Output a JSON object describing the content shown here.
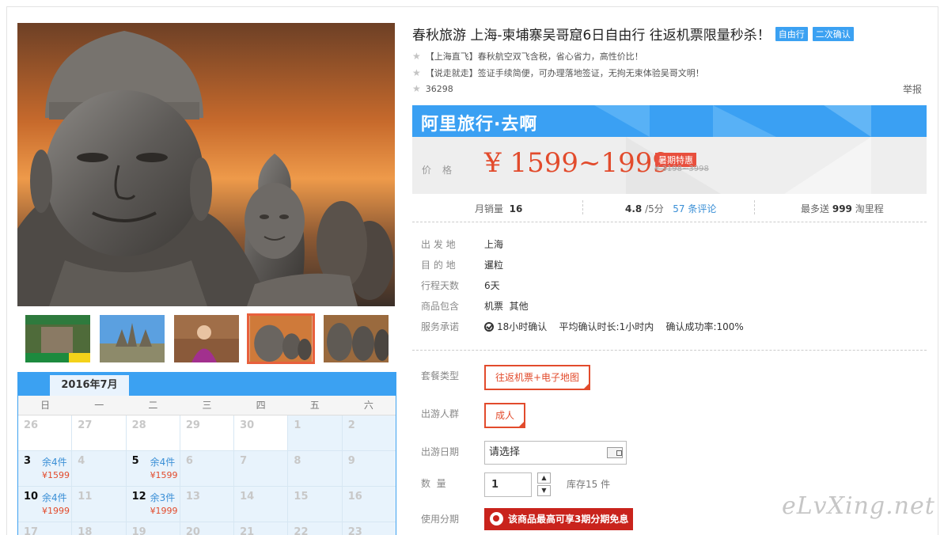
{
  "product": {
    "title": "春秋旅游 上海-柬埔寨吴哥窟6日自由行 往返机票限量秒杀！",
    "tags": [
      "自由行",
      "二次确认"
    ],
    "features": [
      "【上海直飞】春秋航空双飞含税，省心省力，高性价比！",
      "【说走就走】签证手续简便，可办理落地签证，无拘无束体验吴哥文明！"
    ],
    "views": "36298",
    "report_label": "举报"
  },
  "banner": {
    "text": "阿里旅行·去啊"
  },
  "price": {
    "label": "价格",
    "value": "¥ 1599~1999",
    "promo_tag": "暑期特惠",
    "original": "¥ 3198~3998"
  },
  "stats": {
    "sales_label": "月销量",
    "sales_value": "16",
    "rating_value": "4.8",
    "rating_suffix": "/5分",
    "reviews_link": "57 条评论",
    "points_prefix": "最多送",
    "points_value": "999",
    "points_suffix": "淘里程"
  },
  "info": [
    {
      "key": "出 发 地",
      "value": "上海"
    },
    {
      "key": "目 的 地",
      "value": "暹粒"
    },
    {
      "key": "行程天数",
      "value": "6天"
    },
    {
      "key": "商品包含",
      "value": "机票  其他"
    },
    {
      "key": "服务承诺",
      "value": "18小时确认    平均确认时长:1小时内    确认成功率:100%"
    }
  ],
  "options": {
    "package_label": "套餐类型",
    "package_value": "往返机票+电子地图",
    "people_label": "出游人群",
    "people_value": "成人",
    "date_label": "出游日期",
    "date_placeholder": "请选择",
    "qty_label": "数  量",
    "qty_value": "1",
    "stock_text": "库存15 件",
    "installment_label": "使用分期",
    "installment_text": "该商品最高可享3期分期免息"
  },
  "calendar": {
    "month": "2016年7月",
    "weekdays": [
      "日",
      "一",
      "二",
      "三",
      "四",
      "五",
      "六"
    ],
    "weeks": [
      [
        {
          "d": "26"
        },
        {
          "d": "27"
        },
        {
          "d": "28"
        },
        {
          "d": "29"
        },
        {
          "d": "30"
        },
        {
          "d": "1"
        },
        {
          "d": "2"
        }
      ],
      [
        {
          "d": "3",
          "stock": "余4件",
          "price": "¥1599"
        },
        {
          "d": "4"
        },
        {
          "d": "5",
          "stock": "余4件",
          "price": "¥1599"
        },
        {
          "d": "6"
        },
        {
          "d": "7"
        },
        {
          "d": "8"
        },
        {
          "d": "9"
        }
      ],
      [
        {
          "d": "10",
          "stock": "余4件",
          "price": "¥1999"
        },
        {
          "d": "11"
        },
        {
          "d": "12",
          "stock": "余3件",
          "price": "¥1999"
        },
        {
          "d": "13"
        },
        {
          "d": "14"
        },
        {
          "d": "15"
        },
        {
          "d": "16"
        }
      ],
      [
        {
          "d": "17"
        },
        {
          "d": "18"
        },
        {
          "d": "19"
        },
        {
          "d": "20"
        },
        {
          "d": "21"
        },
        {
          "d": "22"
        },
        {
          "d": "23"
        }
      ]
    ]
  },
  "thumbnails": [
    "jungle-temple-ad",
    "angkor-wat",
    "girl-in-purple",
    "stone-faces",
    "bayon-temple"
  ],
  "watermark": "eLvXing.net",
  "colors": {
    "accent": "#3ba1f2",
    "price": "#e24b2c",
    "installment": "#c9231c"
  }
}
